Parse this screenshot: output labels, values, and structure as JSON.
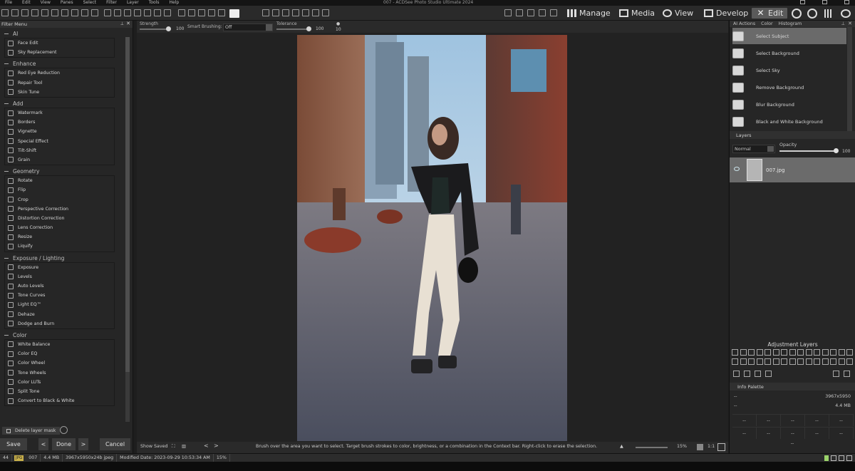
{
  "menubar": {
    "items": [
      "File",
      "Edit",
      "View",
      "Panes",
      "Select",
      "Filter",
      "Layer",
      "Tools",
      "Help"
    ],
    "window_title": "007 - ACDSee Photo Studio Ultimate 2024"
  },
  "modes": {
    "manage": "Manage",
    "media": "Media",
    "view": "View",
    "develop": "Develop",
    "edit": "Edit"
  },
  "filter_menu": {
    "title": "Filter Menu",
    "groups": [
      {
        "label": "AI",
        "items": [
          "Face Edit",
          "Sky Replacement"
        ]
      },
      {
        "label": "Enhance",
        "items": [
          "Red Eye Reduction",
          "Repair Tool",
          "Skin Tune"
        ]
      },
      {
        "label": "Add",
        "items": [
          "Watermark",
          "Borders",
          "Vignette",
          "Special Effect",
          "Tilt-Shift",
          "Grain"
        ]
      },
      {
        "label": "Geometry",
        "items": [
          "Rotate",
          "Flip",
          "Crop",
          "Perspective Correction",
          "Distortion Correction",
          "Lens Correction",
          "Resize",
          "Liquify"
        ]
      },
      {
        "label": "Exposure / Lighting",
        "items": [
          "Exposure",
          "Levels",
          "Auto Levels",
          "Tone Curves",
          "Light EQ™",
          "Dehaze",
          "Dodge and Burn"
        ]
      },
      {
        "label": "Color",
        "items": [
          "White Balance",
          "Color EQ",
          "Color Wheel",
          "Tone Wheels",
          "Color LUTs",
          "Split Tone",
          "Convert to Black & White"
        ]
      }
    ],
    "delete_mask": "Delete layer mask",
    "buttons": {
      "save": "Save",
      "done": "Done",
      "cancel": "Cancel"
    }
  },
  "context_bar": {
    "strength_label": "Strength",
    "strength_value": "100",
    "strength_level": 1.0,
    "smart_brushing_label": "Smart Brushing:",
    "smart_brushing_value": "Off",
    "tolerance_label": "Tolerance",
    "tolerance_value": "100",
    "tolerance_level": 1.0,
    "brush_size": "10"
  },
  "canvas_status": {
    "show_saved": "Show Saved",
    "hint": "Brush over the area you want to select. Target brush strokes to color, brightness, or a combination in the Context bar. Right-click to erase the selection.",
    "zoom": "15%",
    "one_to_one": "1:1"
  },
  "ai_actions": {
    "tabs": [
      "AI Actions",
      "Color",
      "Histogram"
    ],
    "items": [
      "Select Subject",
      "Select Background",
      "Select Sky",
      "Remove Background",
      "Blur Background",
      "Black and White Background"
    ],
    "selected_index": 0
  },
  "layers": {
    "title": "Layers",
    "blend_mode": "Normal",
    "opacity_label": "Opacity",
    "opacity_value": "100",
    "opacity_level": 1.0,
    "layer_name": "007.jpg"
  },
  "adjustment_layers": {
    "title": "Adjustment Layers"
  },
  "info_palette": {
    "title": "Info Palette",
    "dimensions": "3967x5950",
    "size": "4.4 MB",
    "placeholder": "--",
    "row1_left": "--",
    "row2_left": "--"
  },
  "statusbar": {
    "index": "44",
    "format": "JPG",
    "filename": "007",
    "filesize": "4.4 MB",
    "dims": "3967x5950x24b jpeg",
    "modified": "Modified Date: 2023-09-29 10:53:34 AM",
    "zoom": "15%"
  },
  "colors": {
    "accent_select": "#6a6a6a",
    "panel_bg": "#262626",
    "canvas_bg": "#222222"
  }
}
